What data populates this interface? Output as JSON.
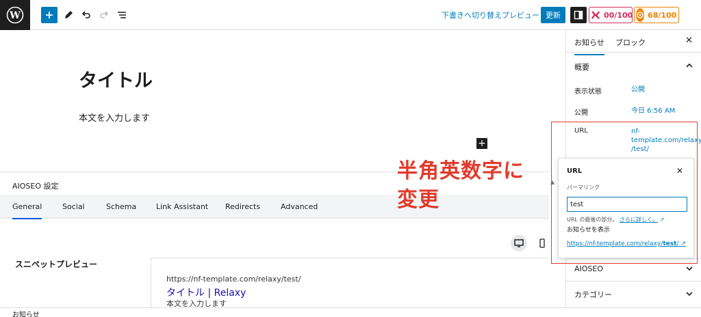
{
  "toolbar": {
    "switch_to_draft": "下書きへ切り替え",
    "preview": "プレビュー",
    "update": "更新",
    "score_headline": "00/100",
    "score_truseo": "68/100"
  },
  "editor": {
    "title": "タイトル",
    "body": "本文を入力します"
  },
  "annotation": {
    "line1": "半角英数字に",
    "line2": "変更"
  },
  "meta_box": {
    "heading": "AIOSEO 設定",
    "tabs": [
      "General",
      "Social",
      "Schema",
      "Link Assistant",
      "Redirects",
      "Advanced"
    ],
    "snippet_label": "スニペットプレビュー",
    "snippet": {
      "url": "https://nf-template.com/relaxy/test/",
      "title": "タイトル | Relaxy",
      "description": "本文を入力します"
    }
  },
  "sidebar": {
    "tab_post": "お知らせ",
    "tab_block": "ブロック",
    "summary": "概要",
    "visibility_label": "表示状態",
    "visibility_value": "公開",
    "publish_label": "公開",
    "publish_value": "今日 6:56 AM",
    "url_label": "URL",
    "url_value_1": "nf-",
    "url_value_2": "template.com/relaxy",
    "url_value_3": "/test/",
    "aioseo": "AIOSEO",
    "category": "カテゴリー"
  },
  "popover": {
    "title": "URL",
    "permalink_label": "パーマリンク",
    "slug_value": "test",
    "help_text": "URL の最後の部分。",
    "help_link": "さらに詳しく。",
    "view_post": "お知らせを表示",
    "link_prefix": "https://nf-template.com/relaxy/",
    "link_slug": "test",
    "link_suffix": "/"
  },
  "footer": {
    "breadcrumb": "お知らせ"
  },
  "colors": {
    "accent": "#007cba",
    "annotation_red": "#e03b2c",
    "headline_score": "#d72b5b",
    "truseo_score": "#f18200"
  }
}
